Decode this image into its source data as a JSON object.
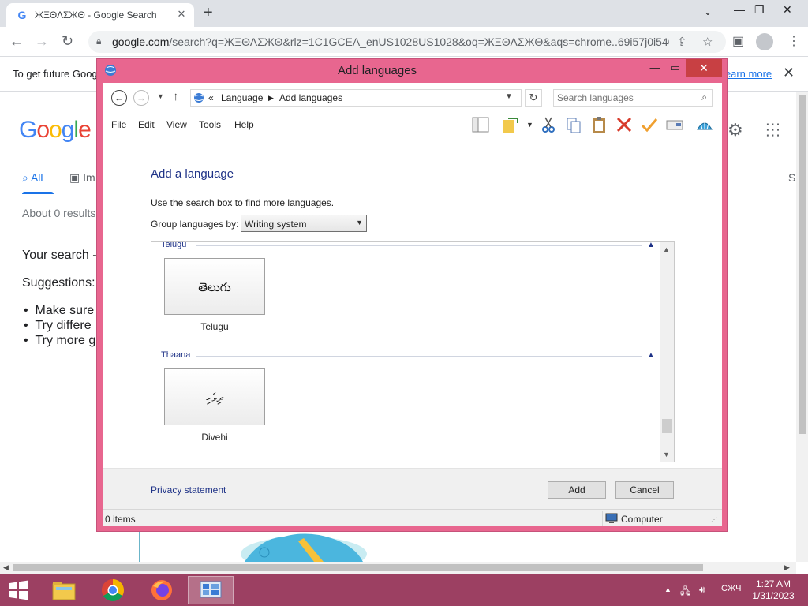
{
  "browser": {
    "tab_title": "ЖΞΘΛΣЖΘ - Google Search",
    "tab_favicon": "G",
    "url_domain": "google.com",
    "url_rest": "/search?q=ЖΞΘΛΣЖΘ&rlz=1C1GCEA_enUS1028US1028&oq=ЖΞΘΛΣЖΘ&aqs=chrome..69i57j0i546...",
    "infobar_text": "To get future Goog",
    "infobar_link": "learn more"
  },
  "google": {
    "logo": [
      "G",
      "o",
      "o",
      "g",
      "l",
      "e"
    ],
    "logo_colors": [
      "#4285f4",
      "#ea4335",
      "#fbbc05",
      "#4285f4",
      "#34a853",
      "#ea4335"
    ],
    "tab_all": "All",
    "tab_images": "Im",
    "tab_more": "S",
    "result_count": "About 0 results",
    "search_line": "Your search -",
    "suggestions_label": "Suggestions:",
    "bullets": [
      "Make sure",
      "Try differe",
      "Try more g"
    ]
  },
  "dialog": {
    "title": "Add languages",
    "breadcrumb_sep": "«",
    "breadcrumb": [
      "Language",
      "Add languages"
    ],
    "search_placeholder": "Search languages",
    "menu": [
      "File",
      "Edit",
      "View",
      "Tools",
      "Help"
    ],
    "heading": "Add a language",
    "hint": "Use the search box to find more languages.",
    "group_label": "Group languages by:",
    "group_value": "Writing system",
    "groups": [
      {
        "name": "Telugu",
        "tile_script": "తెలుగు",
        "language": "Telugu"
      },
      {
        "name": "Thaana",
        "tile_script": "ދިވެހި",
        "language": "Divehi"
      }
    ],
    "privacy_link": "Privacy statement",
    "add_button": "Add",
    "cancel_button": "Cancel",
    "status_items": "0 items",
    "status_location": "Computer"
  },
  "taskbar": {
    "time": "1:27 AM",
    "date": "1/31/2023",
    "input_lang": "СЖЧ"
  }
}
